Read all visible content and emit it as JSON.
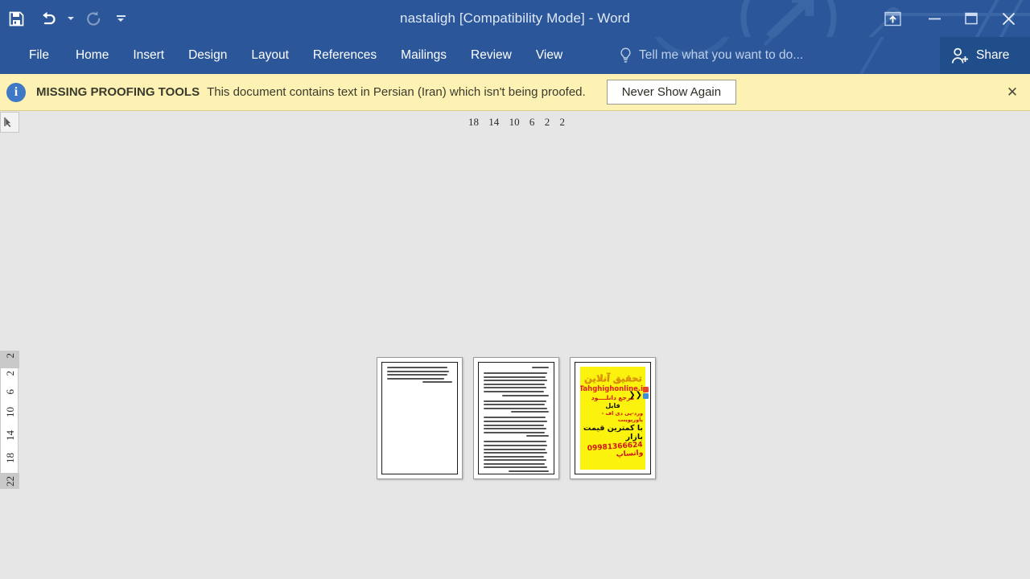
{
  "titlebar": {
    "title": "nastaligh [Compatibility Mode] - Word",
    "qat": [
      {
        "name": "save",
        "label": "Save",
        "icon": "save-icon"
      },
      {
        "name": "undo",
        "label": "Undo",
        "icon": "undo-icon"
      },
      {
        "name": "redo",
        "label": "Repeat",
        "icon": "redo-icon"
      },
      {
        "name": "customize",
        "label": "Customize Quick Access Toolbar",
        "icon": "customize-icon"
      }
    ],
    "window_controls": [
      {
        "name": "ribbon-display-options",
        "label": "Ribbon Display Options"
      },
      {
        "name": "minimize",
        "label": "Minimize"
      },
      {
        "name": "restore",
        "label": "Restore Down"
      },
      {
        "name": "close",
        "label": "Close"
      }
    ]
  },
  "ribbon": {
    "tabs": [
      {
        "label": "File"
      },
      {
        "label": "Home"
      },
      {
        "label": "Insert"
      },
      {
        "label": "Design"
      },
      {
        "label": "Layout"
      },
      {
        "label": "References"
      },
      {
        "label": "Mailings"
      },
      {
        "label": "Review"
      },
      {
        "label": "View"
      }
    ],
    "tellme_placeholder": "Tell me what you want to do...",
    "share_label": "Share"
  },
  "infobar": {
    "icon": "info-icon",
    "heading": "MISSING PROOFING TOOLS",
    "message": "This document contains text in Persian (Iran) which isn't being proofed.",
    "button_label": "Never Show Again",
    "close_label": "✕",
    "background": "#fdf2b3"
  },
  "rulers": {
    "horizontal_ticks": [
      "18",
      "14",
      "10",
      "6",
      "2",
      "2"
    ],
    "vertical_ticks": [
      "2",
      "2",
      "6",
      "10",
      "14",
      "18",
      "22"
    ],
    "tab_selector": "tab-stop-selector"
  },
  "document": {
    "pages": [
      {
        "number": "1",
        "type": "text"
      },
      {
        "number": "2",
        "type": "text"
      },
      {
        "number": "3",
        "type": "ad"
      }
    ],
    "ad": {
      "title": "تحقیق آنلاین",
      "site": "Tahghighonline.ir",
      "line1": "مرجع دانلــــود",
      "line2": "فایل",
      "line3": "ورد-پی دی اف - پاورپوینت",
      "line4": "با کمترین قیمت بازار",
      "phone": "09981366624 واتساپ",
      "background": "#fbf30d"
    }
  },
  "colors": {
    "word_blue": "#2b579a",
    "share_blue": "#204e8a",
    "workspace_gray": "#e6e6e6",
    "infobar_yellow": "#fdf2b3"
  }
}
